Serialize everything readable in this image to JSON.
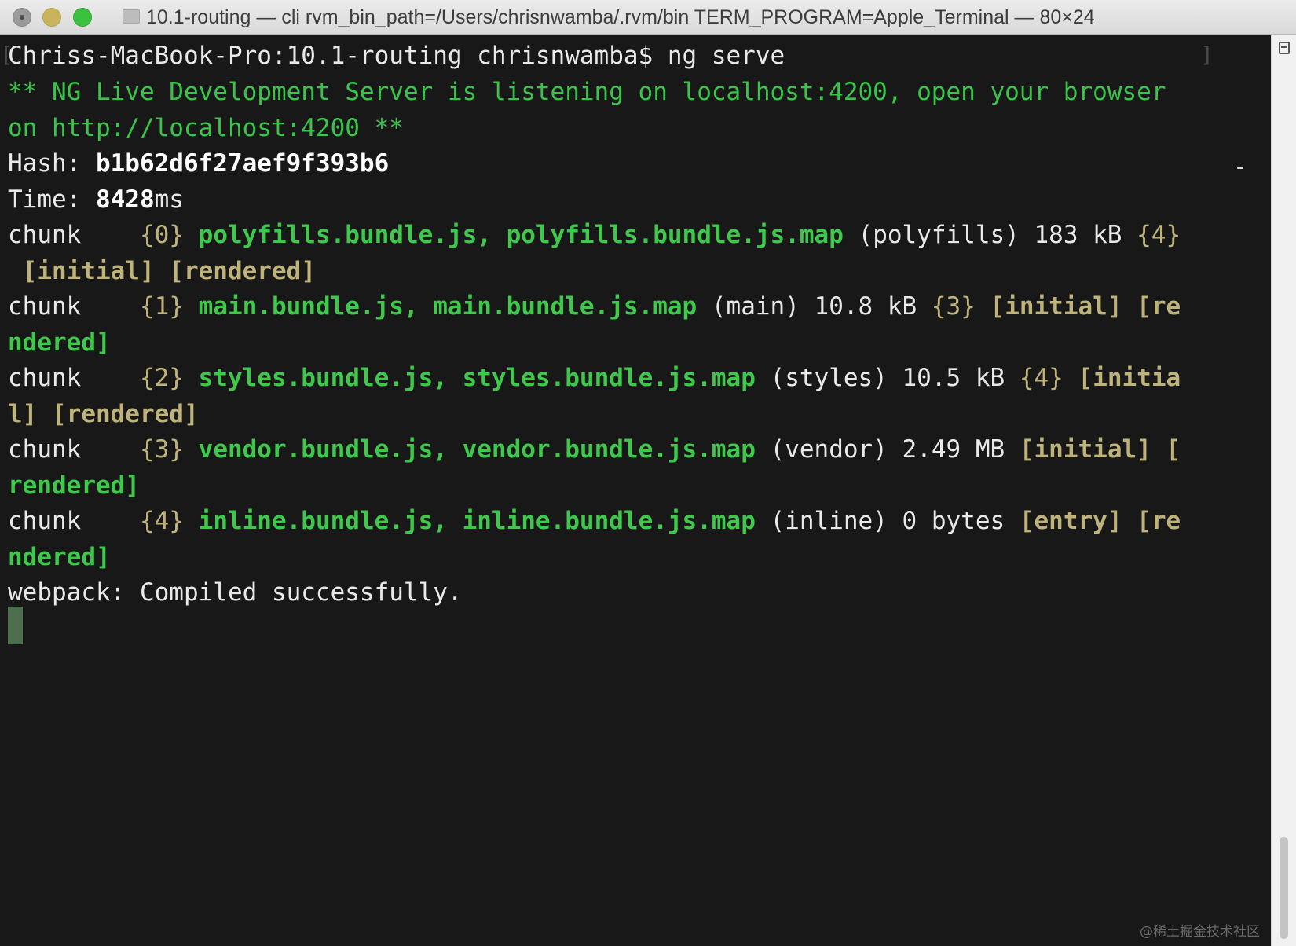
{
  "window": {
    "title": "10.1-routing — cli rvm_bin_path=/Users/chrisnwamba/.rvm/bin TERM_PROGRAM=Apple_Terminal — 80×24"
  },
  "terminal": {
    "prompt": "Chriss-MacBook-Pro:10.1-routing chrisnwamba$ ng serve",
    "ng_line1": "** NG Live Development Server is listening on localhost:4200, open your browser",
    "ng_line2": "on http://localhost:4200 **",
    "hash_label": "Hash: ",
    "hash_value": "b1b62d6f27aef9f393b6",
    "hash_trailing": "-",
    "time_label": "Time: ",
    "time_value": "8428",
    "time_unit": "ms",
    "chunk_word": "chunk    ",
    "chunks": [
      {
        "id": "{0}",
        "files": "polyfills.bundle.js, polyfills.bundle.js.map",
        "name": "(polyfills) 183 kB",
        "parent": "{4}",
        "tags_line1": "",
        "tags_line2": " [initial] [rendered]"
      },
      {
        "id": "{1}",
        "files": "main.bundle.js, main.bundle.js.map",
        "name": "(main) 10.8 kB",
        "parent": "{3}",
        "tags_line1": "[initial] [re",
        "tags_line2": "ndered]"
      },
      {
        "id": "{2}",
        "files": "styles.bundle.js, styles.bundle.js.map",
        "name": "(styles) 10.5 kB",
        "parent": "{4}",
        "tags_line1": "[initia",
        "tags_line2": "l] [rendered]"
      },
      {
        "id": "{3}",
        "files": "vendor.bundle.js, vendor.bundle.js.map",
        "name": "(vendor) 2.49 MB",
        "parent": "",
        "tags_line1": "[initial] [",
        "tags_line2": "rendered]"
      },
      {
        "id": "{4}",
        "files": "inline.bundle.js, inline.bundle.js.map",
        "name": "(inline) 0 bytes",
        "parent": "",
        "tags_line1": "[entry] [re",
        "tags_line2": "ndered]"
      }
    ],
    "compiled": "webpack: Compiled successfully."
  },
  "watermark": "@稀土掘金技术社区",
  "colors": {
    "background": "#181818",
    "foreground": "#e9e9e9",
    "green": "#39c54a",
    "yellow": "#bfb37c",
    "cursor": "#4d6e4d"
  }
}
